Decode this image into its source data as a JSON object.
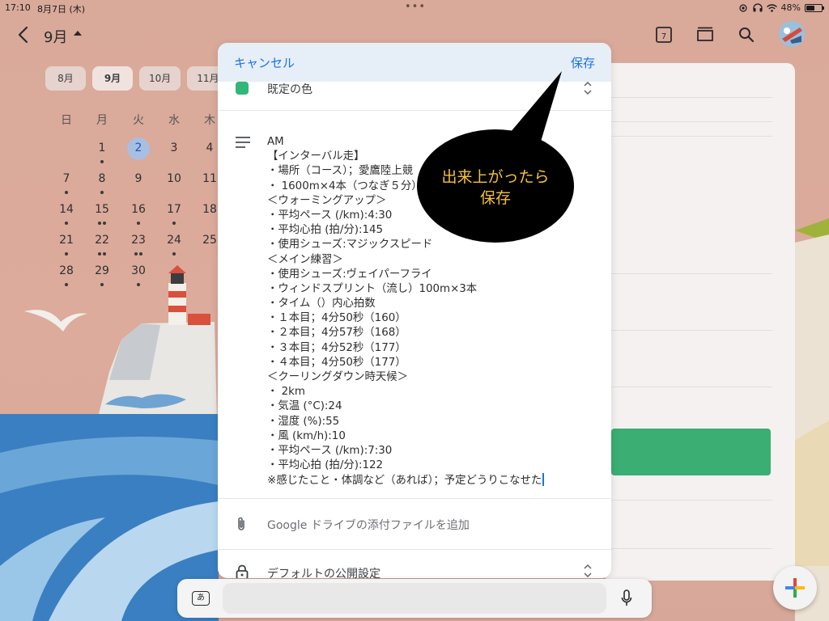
{
  "status_bar": {
    "time": "17:10",
    "date": "8月7日 (木)",
    "battery": "48%",
    "battery_level": 0.48
  },
  "header": {
    "month_title": "9月"
  },
  "month_chips": [
    "8月",
    "9月",
    "10月",
    "11月"
  ],
  "mini_calendar": {
    "weekdays": [
      "日",
      "月",
      "火",
      "水",
      "木"
    ],
    "weeks": [
      [
        "",
        "1",
        "2",
        "3",
        "4"
      ],
      [
        "7",
        "8",
        "9",
        "10",
        "11"
      ],
      [
        "14",
        "15",
        "16",
        "17",
        "18"
      ],
      [
        "21",
        "22",
        "23",
        "24",
        "25"
      ],
      [
        "28",
        "29",
        "30",
        "",
        ""
      ]
    ],
    "today": "2"
  },
  "dialog": {
    "cancel_label": "キャンセル",
    "save_label": "保存",
    "color_label": "既定の色",
    "notes": [
      "AM",
      "【インターバル走】",
      "・場所（コース）；愛鷹陸上競",
      "・ 1600m×4本（つなぎ５分）",
      "＜ウォーミングアップ＞",
      "・平均ペース (/km):4:30",
      "・平均心拍 (拍/分):145",
      "・使用シューズ:マジックスピード",
      "＜メイン練習＞",
      "・使用シューズ:ヴェイパーフライ",
      "・ウィンドスプリント（流し）100m×3本",
      "・タイム（）内心拍数",
      "・１本目；4分50秒（160）",
      "・２本目；4分57秒（168）",
      "・３本目；4分52秒（177）",
      "・４本目；4分50秒（177）",
      "＜クーリングダウン時天候＞",
      "・ 2km",
      "・気温 (°C):24",
      "・湿度 (%):55",
      "・風 (km/h):10",
      "・平均ペース (/km):7:30",
      "・平均心拍 (拍/分):122",
      "※感じたこと・体調など（あれば）；予定どうりこなせた"
    ],
    "attach_label": "Google ドライブの添付ファイルを追加",
    "visibility_label": "デフォルトの公開設定"
  },
  "callout": {
    "line1": "出来上がったら",
    "line2": "保存"
  },
  "keyboard": {
    "key_label": "あ"
  },
  "icons": {
    "back": "chevron-left-icon",
    "today": "calendar-today-icon",
    "view": "view-toggle-icon",
    "search": "search-icon",
    "notes": "notes-icon",
    "attach": "paperclip-icon",
    "lock": "lock-icon",
    "mic": "mic-icon",
    "fab": "plus-icon"
  },
  "colors": {
    "accent": "#1a73e8",
    "event_color": "#33b679",
    "callout_text": "#f3c13a"
  }
}
